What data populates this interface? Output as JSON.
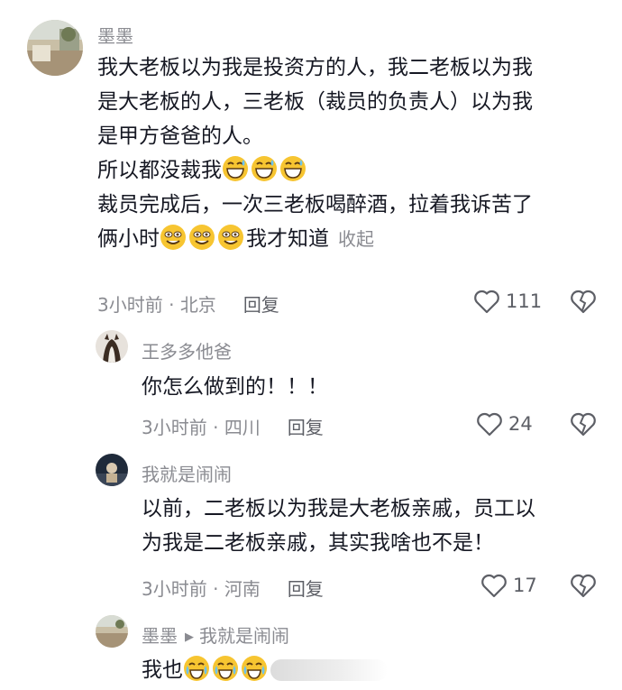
{
  "comments": [
    {
      "username": "墨墨",
      "lines": [
        "我大老板以为我是投资方的人，我二老板以为我",
        "是大老板的人，三老板（裁员的负责人）以为我",
        "是甲方爸爸的人。",
        "所以都没裁我",
        "裁员完成后，一次三老板喝醉酒，拉着我诉苦了",
        "俩小时",
        "我才知道"
      ],
      "collapse_label": "收起",
      "time": "3小时前",
      "location": "北京",
      "reply_label": "回复",
      "likes": "111"
    },
    {
      "username": "王多多他爸",
      "lines": [
        "你怎么做到的！！！"
      ],
      "time": "3小时前",
      "location": "四川",
      "reply_label": "回复",
      "likes": "24"
    },
    {
      "username": "我就是闹闹",
      "lines": [
        "以前，二老板以为我是大老板亲戚，员工以",
        "为我是二老板亲戚，其实我啥也不是！"
      ],
      "time": "3小时前",
      "location": "河南",
      "reply_label": "回复",
      "likes": "17"
    },
    {
      "username": "墨墨",
      "reply_to": "我就是闹闹",
      "lines": [
        "我也"
      ]
    }
  ],
  "icons": {
    "like": "heart-outline-icon",
    "dislike": "broken-heart-icon",
    "reply_arrow": "triangle-right-icon",
    "emoji_laugh": "grinning-sweat-emoji",
    "emoji_smirk": "squinting-smile-emoji",
    "emoji_cry": "crying-emoji"
  },
  "colors": {
    "text": "#161823",
    "secondary": "#8a8b91",
    "action": "#5d5f66"
  }
}
